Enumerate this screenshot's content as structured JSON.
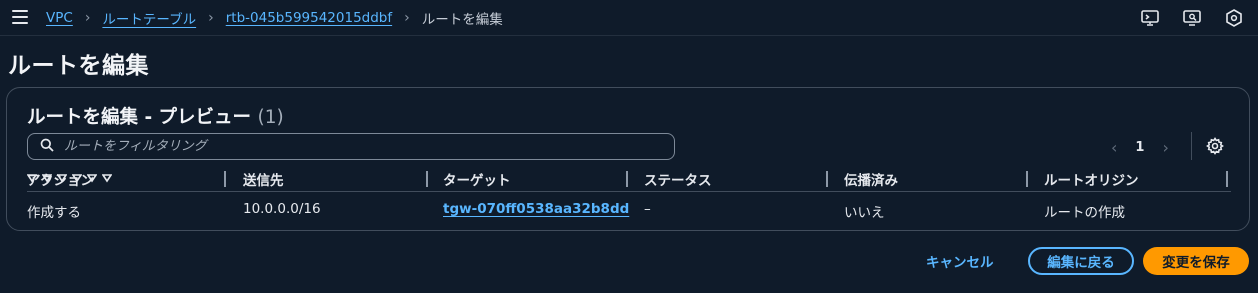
{
  "breadcrumb": {
    "items": [
      {
        "label": "VPC"
      },
      {
        "label": "ルートテーブル"
      },
      {
        "label": "rtb-045b599542015ddbf"
      }
    ],
    "current": "ルートを編集"
  },
  "page": {
    "title": "ルートを編集"
  },
  "panel": {
    "title": "ルートを編集 - プレビュー",
    "count": "(1)"
  },
  "search": {
    "placeholder": "ルートをフィルタリング"
  },
  "pagination": {
    "prev": "‹",
    "page": "1",
    "next": "›"
  },
  "table": {
    "columns": [
      "アクション",
      "送信先",
      "ターゲット",
      "ステータス",
      "伝播済み",
      "ルートオリジン"
    ],
    "rows": [
      {
        "action": "作成する",
        "destination": "10.0.0.0/16",
        "target": "tgw-070ff0538aa32b8dd",
        "status": "–",
        "propagated": "いいえ",
        "origin": "ルートの作成"
      }
    ]
  },
  "actions": {
    "cancel": "キャンセル",
    "back": "編集に戻る",
    "save": "変更を保存"
  },
  "colors": {
    "background": "#0f1b2a",
    "link": "#59b6ff",
    "primary": "#ff9900"
  },
  "icons": [
    "menu-icon",
    "cloudshell-icon",
    "feedback-icon",
    "settings-shield-icon",
    "search-icon",
    "gear-icon",
    "sort-down-icon"
  ]
}
